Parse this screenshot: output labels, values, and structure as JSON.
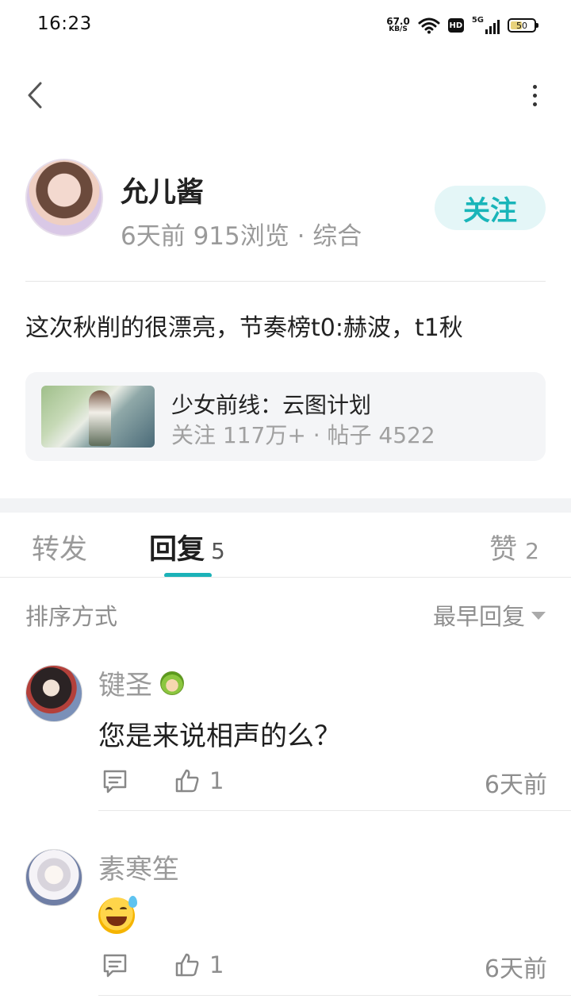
{
  "status_bar": {
    "time": "16:23",
    "net_speed_value": "67.0",
    "net_speed_unit": "KB/S",
    "hd_label": "HD",
    "signal_label": "5G",
    "battery": "50"
  },
  "post": {
    "author_name": "允儿酱",
    "meta": "6天前 915浏览 · 综合",
    "follow_label": "关注",
    "text": "这次秋削的很漂亮，节奏榜t0:赫波，t1秋"
  },
  "forum": {
    "name": "少女前线：云图计划",
    "stats": "关注 117万+ · 帖子 4522"
  },
  "tabs": {
    "repost": "转发",
    "reply": "回复",
    "reply_count": "5",
    "like": "赞",
    "like_count": "2"
  },
  "sort": {
    "label": "排序方式",
    "value": "最早回复"
  },
  "comments": [
    {
      "user": "键圣",
      "text": "您是来说相声的么？",
      "emoji": "",
      "likes": "1",
      "time": "6天前"
    },
    {
      "user": "素寒笙",
      "text": "",
      "emoji": "sweat-smile-emoji",
      "likes": "1",
      "time": "6天前"
    }
  ],
  "colors": {
    "accent": "#1cb2b8",
    "follow_bg": "#e4f6f7",
    "muted_text": "#9a9a9a"
  }
}
